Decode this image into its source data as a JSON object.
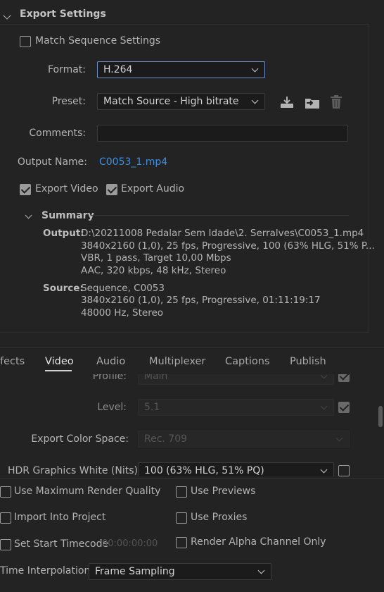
{
  "export_settings": {
    "title": "Export Settings",
    "match_sequence_label": "Match Sequence Settings",
    "match_sequence_checked": false,
    "format_label": "Format:",
    "format_value": "H.264",
    "preset_label": "Preset:",
    "preset_value": "Match Source - High bitrate",
    "comments_label": "Comments:",
    "comments_value": "",
    "output_name_label": "Output Name:",
    "output_name_value": "C0053_1.mp4",
    "export_video_label": "Export Video",
    "export_video_checked": true,
    "export_audio_label": "Export Audio",
    "export_audio_checked": true
  },
  "summary": {
    "title": "Summary",
    "output_key": "Output:",
    "output_lines": [
      "D:\\20211008 Pedalar Sem Idade\\2. Serralves\\C0053_1.mp4",
      "3840x2160 (1,0), 25 fps, Progressive, 100 (63% HLG, 51% P...",
      "VBR, 1 pass, Target 10,00 Mbps",
      "AAC, 320 kbps, 48 kHz, Stereo"
    ],
    "source_key": "Source:",
    "source_lines": [
      "Sequence, C0053",
      "3840x2160 (1,0), 25 fps, Progressive, 01:11:19:17",
      "48000 Hz, Stereo"
    ]
  },
  "tabs": [
    {
      "label": "fects"
    },
    {
      "label": "Video"
    },
    {
      "label": "Audio"
    },
    {
      "label": "Multiplexer"
    },
    {
      "label": "Captions"
    },
    {
      "label": "Publish"
    }
  ],
  "active_tab": "Video",
  "video": {
    "profile_label": "Profile:",
    "profile_value": "Main",
    "level_label": "Level:",
    "level_value": "5.1",
    "color_space_label": "Export Color Space:",
    "color_space_value": "Rec. 709",
    "hdr_label": "HDR Graphics White (Nits):",
    "hdr_value": "100 (63% HLG, 51% PQ)"
  },
  "bottom": {
    "max_render_label": "Use Maximum Render Quality",
    "use_previews_label": "Use Previews",
    "import_project_label": "Import Into Project",
    "use_proxies_label": "Use Proxies",
    "set_start_tc_label": "Set Start Timecode",
    "start_tc_value": "00:00:00:00",
    "render_alpha_label": "Render Alpha Channel Only",
    "time_interp_label": "Time Interpolation:",
    "time_interp_value": "Frame Sampling"
  },
  "colors": {
    "background": "#232323",
    "link": "#3d8fe0",
    "focus_border": "#6e8fc8"
  }
}
